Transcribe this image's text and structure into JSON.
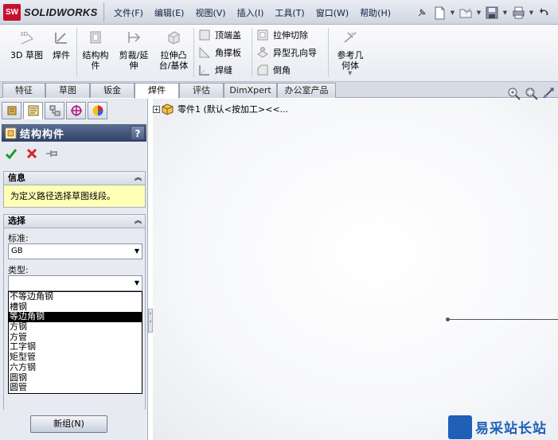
{
  "app": {
    "logo_text": "SOLIDWORKS",
    "logo_mark": "SW",
    "brand_color": "#c8102e"
  },
  "menu": [
    "文件(F)",
    "编辑(E)",
    "视图(V)",
    "插入(I)",
    "工具(T)",
    "窗口(W)",
    "帮助(H)"
  ],
  "command_manager": {
    "sketch_3d": "3D 草图",
    "weldment": "焊件",
    "structural_member": [
      "结构构",
      "件"
    ],
    "trim_extend": [
      "剪裁/延",
      "伸"
    ],
    "extrude_boss": [
      "拉伸凸",
      "台/基体"
    ],
    "end_cap": "顶端盖",
    "gusset": "角撑板",
    "weld_bead": "焊缝",
    "extruded_cut": "拉伸切除",
    "hole_wizard": "异型孔向导",
    "chamfer": "倒角",
    "reference_geometry": [
      "参考几",
      "何体"
    ]
  },
  "tabs": [
    {
      "label": "特征",
      "active": false
    },
    {
      "label": "草图",
      "active": false
    },
    {
      "label": "钣金",
      "active": false
    },
    {
      "label": "焊件",
      "active": true
    },
    {
      "label": "评估",
      "active": false
    },
    {
      "label": "DimXpert",
      "active": false
    },
    {
      "label": "办公室产品",
      "active": false
    }
  ],
  "property_manager": {
    "title": "结构构件",
    "help": "?",
    "info": {
      "header": "信息",
      "message": "为定义路径选择草图线段。"
    },
    "selection": {
      "header": "选择",
      "standard_label": "标准:",
      "standard_value": "GB",
      "type_label": "类型:",
      "type_value": "",
      "type_options": [
        "不等边角钢",
        "槽钢",
        "等边角钢",
        "方钢",
        "方管",
        "工字钢",
        "矩型管",
        "六方钢",
        "圆钢",
        "圆管"
      ],
      "selected_option": "等边角钢"
    },
    "new_group": "新组(N)"
  },
  "feature_tree": {
    "root": "零件1 (默认<按加工><<..."
  },
  "watermark": {
    "text": "易采站长站"
  }
}
